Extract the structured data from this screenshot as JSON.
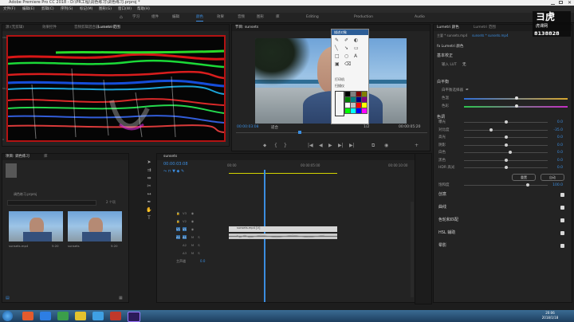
{
  "app": {
    "title": "Adobe Premiere Pro CC 2018 - D:\\PR工程\\调色练习\\调色练习.prproj *",
    "menu": [
      "文件(F)",
      "编辑(E)",
      "剪辑(C)",
      "序列(S)",
      "标记(M)",
      "图形(G)",
      "窗口(W)",
      "帮助(H)"
    ]
  },
  "workspaces": {
    "tabs": [
      "学习",
      "组件",
      "编辑",
      "颜色",
      "效果",
      "音频",
      "图形",
      "库",
      "Editing",
      "Assembly",
      "Color",
      "Effects",
      "Audio",
      "Graphics",
      "Libraries",
      "Captions",
      "Learning",
      "Production"
    ],
    "active": "颜色"
  },
  "source_panel": {
    "tabs": [
      "源:(无剪辑)",
      "效果控件",
      "音频剪辑混合器: sunsets",
      "Lumetri 范围"
    ],
    "active_tab": "Lumetri 范围",
    "scale_labels": [
      "1023",
      "896",
      "768",
      "640",
      "512",
      "384",
      "256",
      "128",
      "0"
    ]
  },
  "program_panel": {
    "tab": "节目: sunsets",
    "timecode_left": "00:00:03:08",
    "zoom": "适合",
    "quality": "1/2",
    "timecode_right": "00:00:05:20"
  },
  "color_picker": {
    "title": "描述对象",
    "items": [
      "打印机",
      "扫描仪",
      "共享"
    ],
    "swatch_colors": [
      "#000000",
      "#808080",
      "#800000",
      "#808000",
      "#008000",
      "#008080",
      "#000080",
      "#800080",
      "#ffffff",
      "#c0c0c0",
      "#ff0000",
      "#ffff00",
      "#00ff00",
      "#00ffff",
      "#0000ff",
      "#ff00ff"
    ]
  },
  "project_panel": {
    "tabs": [
      "项目: 调色练习",
      "库"
    ],
    "bin_label": "调色练习.prproj",
    "item_count": "2 个项",
    "items": [
      {
        "name": "sunsets.mp4",
        "duration": "5:20"
      },
      {
        "name": "sunsets",
        "duration": "5:20"
      }
    ]
  },
  "timeline": {
    "tab": "sunsets",
    "timecode": "00:00:03:08",
    "ruler": [
      "00:00",
      "00:00:05:00",
      "00:00:10:00"
    ],
    "video_tracks": [
      "V3",
      "V2",
      "V1"
    ],
    "audio_tracks": [
      "A1",
      "A2",
      "A3"
    ],
    "master": "主声道",
    "master_value": "0.0",
    "clip_label": "sunsets.mp4 [V]"
  },
  "lumetri": {
    "tabs": [
      "Lumetri 颜色",
      "Lumetri 范围"
    ],
    "active_tab": "Lumetri 颜色",
    "breadcrumb_source": "主要 * sunsets.mp4",
    "breadcrumb_seq": "sunsets * sunsets.mp4",
    "fx": "fx Lumetri 颜色",
    "basic": "基本校正",
    "input_lut": "输入 LUT",
    "input_lut_value": "无",
    "white_balance": "白平衡",
    "wb_picker": "白平衡选择器",
    "tone": "色调",
    "temp": "色温",
    "tint": "色彩",
    "rows": [
      {
        "label": "曝光",
        "value": "0.0",
        "pos": 0.5
      },
      {
        "label": "对比度",
        "value": "-35.0",
        "pos": 0.32
      },
      {
        "label": "高光",
        "value": "0.0",
        "pos": 0.5
      },
      {
        "label": "阴影",
        "value": "0.0",
        "pos": 0.5
      },
      {
        "label": "白色",
        "value": "0.0",
        "pos": 0.55
      },
      {
        "label": "黑色",
        "value": "0.0",
        "pos": 0.5
      },
      {
        "label": "HDR 高光",
        "value": "0.0",
        "pos": 0.5
      }
    ],
    "reset_btn": "重置",
    "auto_btn": "自动",
    "saturation": "饱和度",
    "saturation_value": "100.0",
    "sections": [
      "创意",
      "曲线",
      "色轮和匹配",
      "HSL 辅助",
      "晕影"
    ]
  },
  "watermark": {
    "text": "虎课网",
    "id": "8138828"
  },
  "taskbar": {
    "time": "20:06",
    "date": "2018/1/18"
  }
}
